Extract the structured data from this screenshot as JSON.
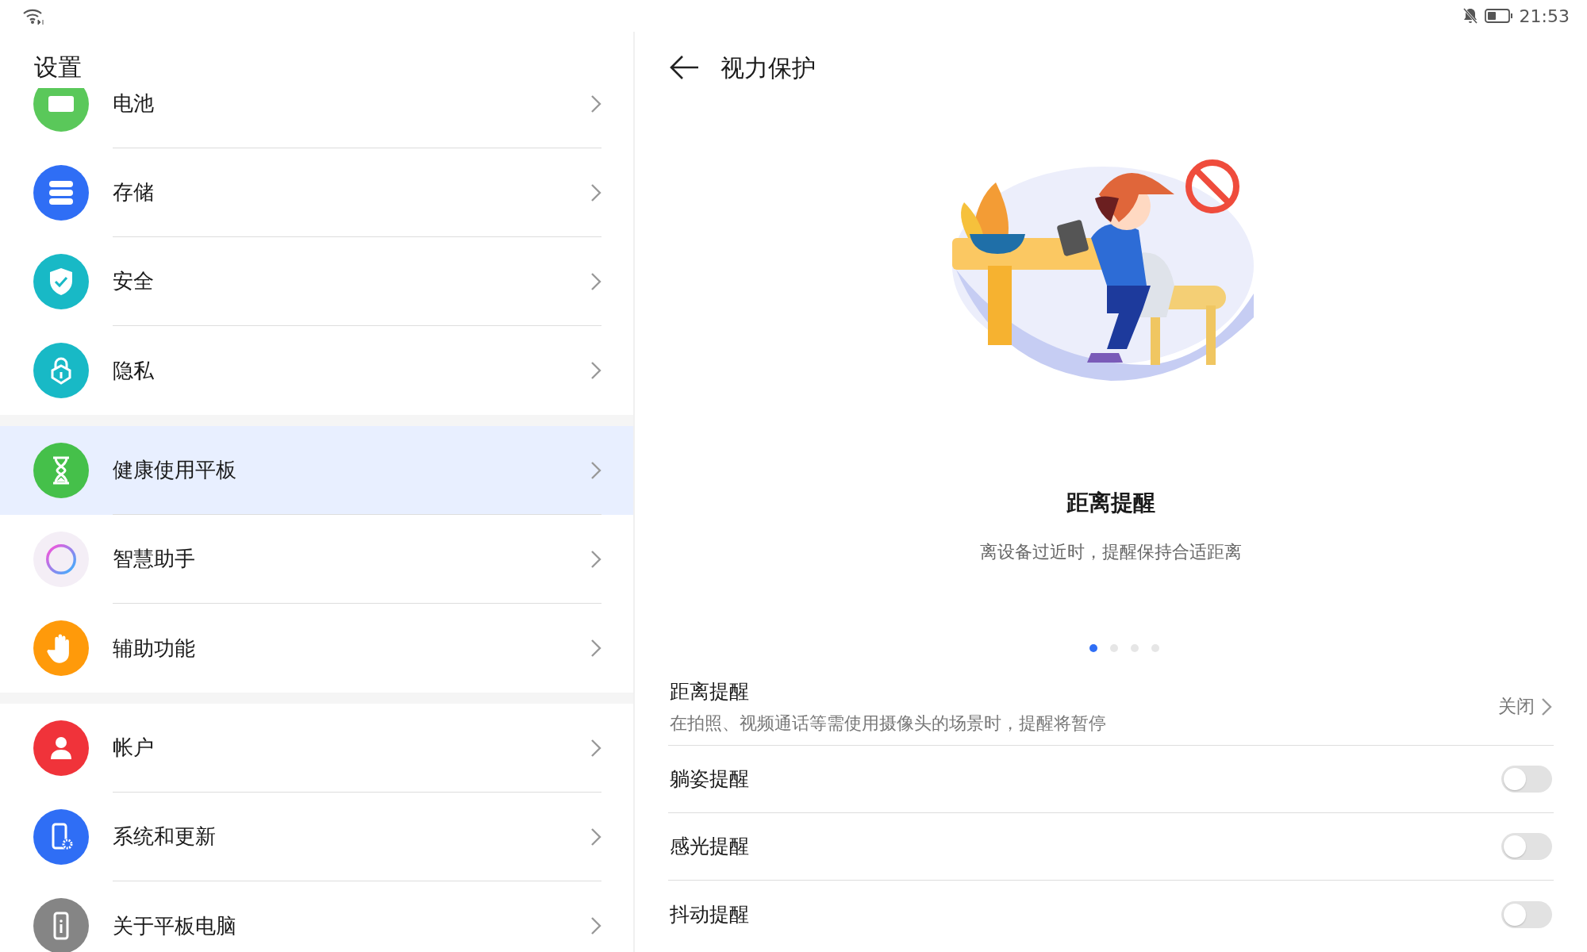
{
  "status_bar": {
    "time": "21:53"
  },
  "sidebar": {
    "title": "设置",
    "groups": [
      [
        {
          "label": "电池",
          "color": "#5ac85a",
          "selected": false
        },
        {
          "label": "存储",
          "color": "#2f6ef5",
          "selected": false
        },
        {
          "label": "安全",
          "color": "#18b9c6",
          "selected": false
        },
        {
          "label": "隐私",
          "color": "#18b9c6",
          "selected": false
        }
      ],
      [
        {
          "label": "健康使用平板",
          "color": "#45c04a",
          "selected": true
        },
        {
          "label": "智慧助手",
          "color": "#f4eef6",
          "selected": false
        },
        {
          "label": "辅助功能",
          "color": "#ff9a0a",
          "selected": false
        }
      ],
      [
        {
          "label": "帐户",
          "color": "#f0333a",
          "selected": false
        },
        {
          "label": "系统和更新",
          "color": "#2f6ef5",
          "selected": false
        },
        {
          "label": "关于平板电脑",
          "color": "#858585",
          "selected": false
        }
      ]
    ]
  },
  "page": {
    "title": "视力保护",
    "feature": {
      "title": "距离提醒",
      "description": "离设备过近时，提醒保持合适距离"
    },
    "pager": [
      {
        "selected": true
      },
      {
        "selected": false
      },
      {
        "selected": false
      },
      {
        "selected": false
      }
    ],
    "settings": [
      {
        "kind": "link",
        "title": "距离提醒",
        "subtitle": "在拍照、视频通话等需使用摄像头的场景时，提醒将暂停",
        "value": "关闭"
      },
      {
        "kind": "toggle",
        "title": "躺姿提醒",
        "on": false
      },
      {
        "kind": "toggle",
        "title": "感光提醒",
        "on": false
      },
      {
        "kind": "toggle",
        "title": "抖动提醒",
        "on": false
      }
    ]
  }
}
